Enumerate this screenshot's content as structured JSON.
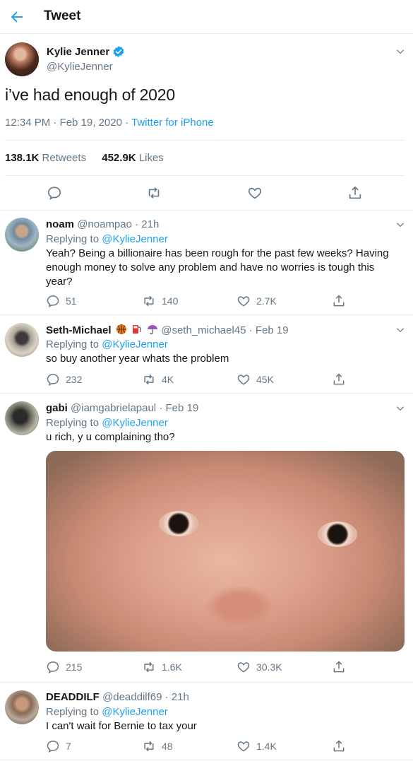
{
  "header": {
    "title": "Tweet"
  },
  "main_tweet": {
    "name": "Kylie Jenner",
    "handle": "@KylieJenner",
    "text": "i’ve had enough of 2020",
    "time": "12:34 PM · Feb 19, 2020",
    "separator": " · ",
    "source": "Twitter for iPhone",
    "retweets": "138.1K",
    "retweets_label": " Retweets",
    "likes": "452.9K",
    "likes_label": " Likes"
  },
  "replies": [
    {
      "name": "noam",
      "handle": "@noampao",
      "time": "· 21h",
      "replying_prefix": "Replying to ",
      "replying_to": "@KylieJenner",
      "text": "Yeah? Being a billionaire has been rough for the past few weeks? Having enough money to solve any problem and have no worries is tough this year?",
      "replies": "51",
      "retweets": "140",
      "likes": "2.7K"
    },
    {
      "name": "Seth-Michael",
      "handle": "@seth_michael45",
      "time": "· Feb 19",
      "replying_prefix": "Replying to ",
      "replying_to": "@KylieJenner",
      "text": "so buy another year whats the problem",
      "replies": "232",
      "retweets": "4K",
      "likes": "45K"
    },
    {
      "name": "gabi",
      "handle": "@iamgabrielapaul",
      "time": "· Feb 19",
      "replying_prefix": "Replying to ",
      "replying_to": "@KylieJenner",
      "text": "u rich, y u complaining tho?",
      "replies": "215",
      "retweets": "1.6K",
      "likes": "30.3K"
    },
    {
      "name": "DEADDILF",
      "handle": "@deaddilf69",
      "time": "· 21h",
      "replying_prefix": "Replying to ",
      "replying_to": "@KylieJenner",
      "text": "I can't wait for Bernie to tax your",
      "replies": "7",
      "retweets": "48",
      "likes": "1.4K"
    }
  ],
  "colors": {
    "accent": "#1da1f2",
    "muted": "#657786",
    "divider": "#e6ecf0",
    "text": "#14171a"
  }
}
